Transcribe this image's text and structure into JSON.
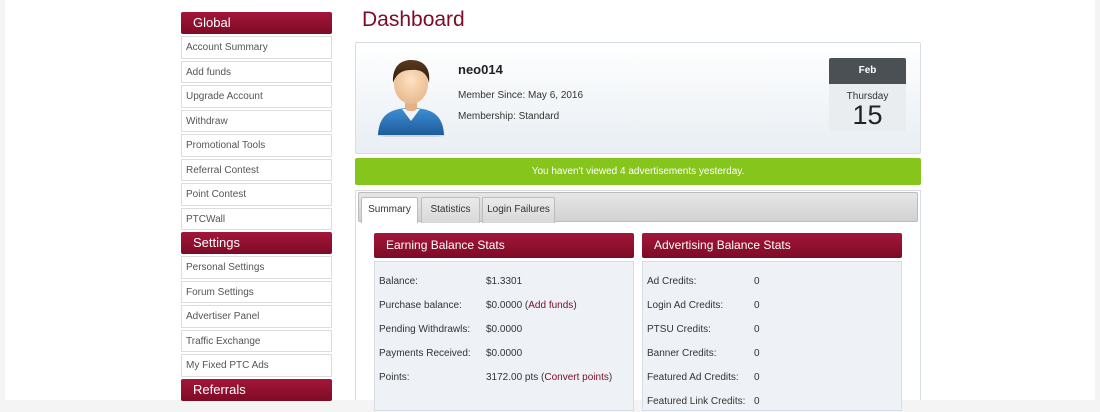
{
  "sidebar": {
    "sections": [
      {
        "title": "Global",
        "items": [
          "Account Summary",
          "Add funds",
          "Upgrade Account",
          "Withdraw",
          "Promotional Tools",
          "Referral Contest",
          "Point Contest",
          "PTCWall"
        ]
      },
      {
        "title": "Settings",
        "items": [
          "Personal Settings",
          "Forum Settings",
          "Advertiser Panel",
          "Traffic Exchange",
          "My Fixed PTC Ads"
        ]
      },
      {
        "title": "Referrals",
        "items": []
      }
    ]
  },
  "page_title": "Dashboard",
  "profile": {
    "username": "neo014",
    "member_since": "Member Since: May 6, 2016",
    "membership": "Membership: Standard"
  },
  "date": {
    "month": "Feb",
    "weekday": "Thursday",
    "day": "15"
  },
  "alert": "You haven't viewed 4 advertisements yesterday.",
  "tabs": [
    "Summary",
    "Statistics",
    "Login Failures"
  ],
  "earning": {
    "title": "Earning Balance Stats",
    "rows": [
      {
        "label": "Balance:",
        "value": "$1.3301",
        "link": "",
        "suffix": ""
      },
      {
        "label": "Purchase balance:",
        "value": "$0.0000 (",
        "link": "Add funds",
        "suffix": ")"
      },
      {
        "label": "Pending Withdrawls:",
        "value": "$0.0000",
        "link": "",
        "suffix": ""
      },
      {
        "label": "Payments Received:",
        "value": "$0.0000",
        "link": "",
        "suffix": ""
      },
      {
        "label": "Points:",
        "value": "3172.00 pts (",
        "link": "Convert points",
        "suffix": ")"
      }
    ]
  },
  "advertising": {
    "title": "Advertising Balance Stats",
    "rows": [
      {
        "label": "Ad Credits:",
        "value": "0"
      },
      {
        "label": "Login Ad Credits:",
        "value": "0"
      },
      {
        "label": "PTSU Credits:",
        "value": "0"
      },
      {
        "label": "Banner Credits:",
        "value": "0"
      },
      {
        "label": "Featured Ad Credits:",
        "value": "0"
      },
      {
        "label": "Featured Link Credits:",
        "value": "0"
      }
    ]
  },
  "icons": {
    "avatar": "user-avatar-icon"
  },
  "colors": {
    "brand": "#7d0b26",
    "alert_bg": "#86c51c",
    "date_header": "#4b5055"
  }
}
